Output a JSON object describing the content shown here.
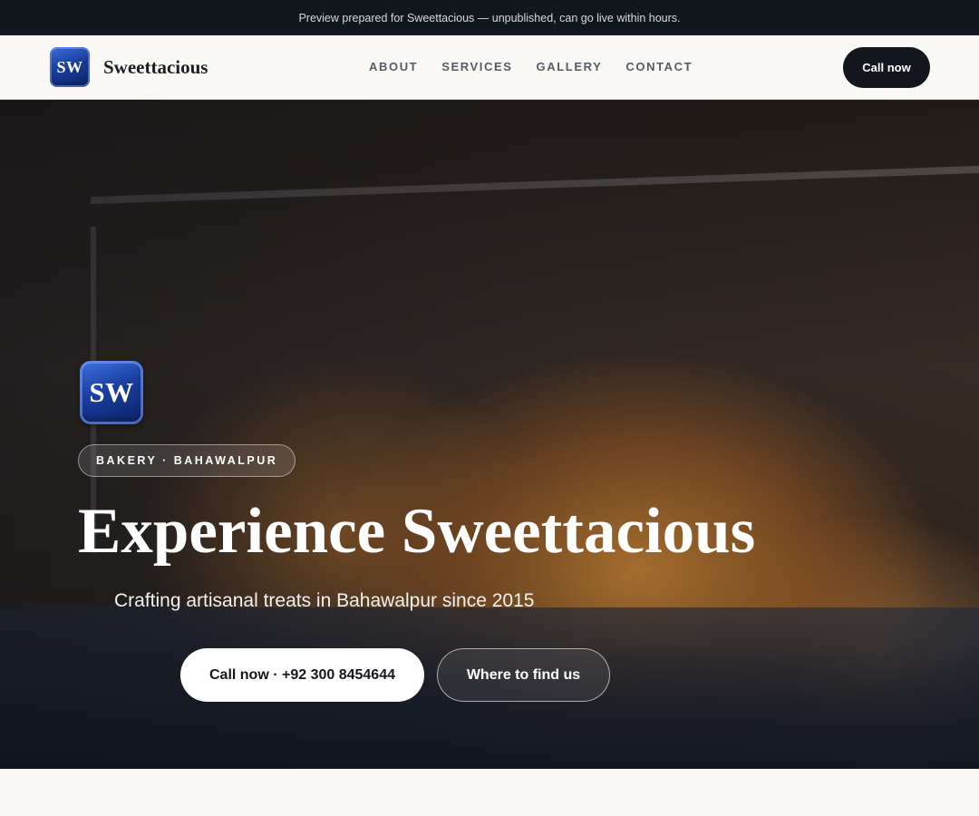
{
  "banner": {
    "text": "Preview prepared for Sweettacious — unpublished, can go live within hours."
  },
  "nav": {
    "logo_initials": "SW",
    "brand": "Sweettacious",
    "links": [
      "ABOUT",
      "SERVICES",
      "GALLERY",
      "CONTACT"
    ],
    "cta_label": "Call now"
  },
  "hero": {
    "badge_initials": "SW",
    "pill": "BAKERY · BAHAWALPUR",
    "headline": "Experience Sweettacious",
    "subheadline": "Crafting artisanal treats in Bahawalpur since 2015",
    "primary_button": "Call now · +92 300 8454644",
    "secondary_button": "Where to find us",
    "background_image": "bakery display case with golden pastries"
  },
  "colors": {
    "dark": "#14171d",
    "logo_blue": "#1a3e9e",
    "page_bg": "#faf9f6"
  }
}
